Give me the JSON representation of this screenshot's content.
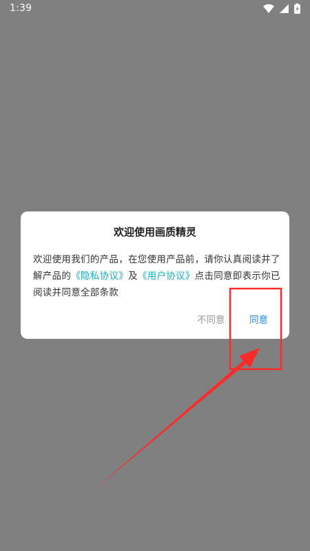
{
  "colors": {
    "overlay": "#808080",
    "link": "#14b1c4",
    "agree": "#2a8ee8",
    "annotation_red": "#ff2a2a"
  },
  "status_bar": {
    "time": "1:39",
    "icons": [
      "wifi-icon",
      "cellular-signal-icon",
      "battery-charging-icon"
    ]
  },
  "dialog": {
    "title": "欢迎使用画质精灵",
    "body": {
      "text_1": "欢迎使用我们的产品，在您使用产品前，请你认真阅读并了解产品的",
      "privacy_link": "《隐私协议》",
      "text_2": "及",
      "user_link": "《用户协议》",
      "text_3": "点击同意即表示你已阅读并同意全部条款"
    },
    "disagree_label": "不同意",
    "agree_label": "同意"
  }
}
